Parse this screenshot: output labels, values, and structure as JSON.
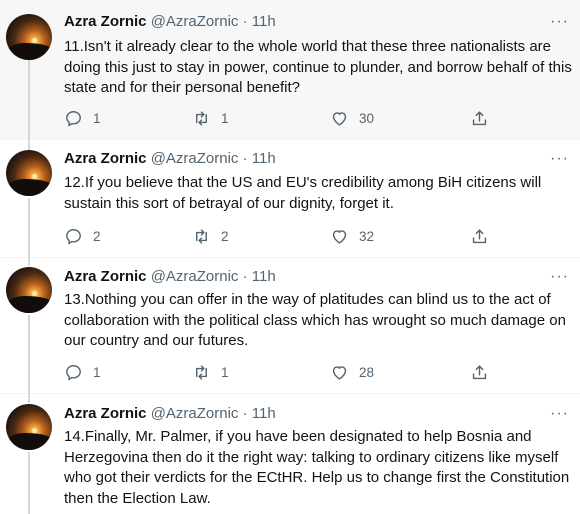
{
  "tweets": [
    {
      "name": "Azra Zornic",
      "handle": "@AzraZornic",
      "time": "11h",
      "text": "11.Isn't it already clear to the whole world that these three nationalists are doing this just to stay in power, continue to plunder, and borrow behalf of this state and for their personal benefit?",
      "replies": "1",
      "retweets": "1",
      "likes": "30"
    },
    {
      "name": "Azra Zornic",
      "handle": "@AzraZornic",
      "time": "11h",
      "text": "12.If you believe that the US and EU's credibility among BiH citizens will sustain this sort of betrayal of our dignity, forget it.",
      "replies": "2",
      "retweets": "2",
      "likes": "32"
    },
    {
      "name": "Azra Zornic",
      "handle": "@AzraZornic",
      "time": "11h",
      "text": "13.Nothing you can offer in the way of platitudes can blind us to the act of collaboration with the political class which has wrought so much damage on our country and our futures.",
      "replies": "1",
      "retweets": "1",
      "likes": "28"
    },
    {
      "name": "Azra Zornic",
      "handle": "@AzraZornic",
      "time": "11h",
      "text": "14.Finally, Mr. Palmer, if you have been designated to help Bosnia and Herzegovina then do it the right way: talking to ordinary citizens like myself who got their verdicts for the ECtHR. Help us to change first the Constitution then the Election Law."
    }
  ],
  "separator": "·",
  "icons": {
    "avatar": "sunset-avatar",
    "reply": "reply-icon",
    "retweet": "retweet-icon",
    "like": "heart-icon",
    "share": "share-icon",
    "more": "more-icon"
  },
  "colors": {
    "text": "#0f1419",
    "secondary": "#536471",
    "highlight_bg": "#f7f7f7",
    "thread_line": "#cfd9de"
  }
}
